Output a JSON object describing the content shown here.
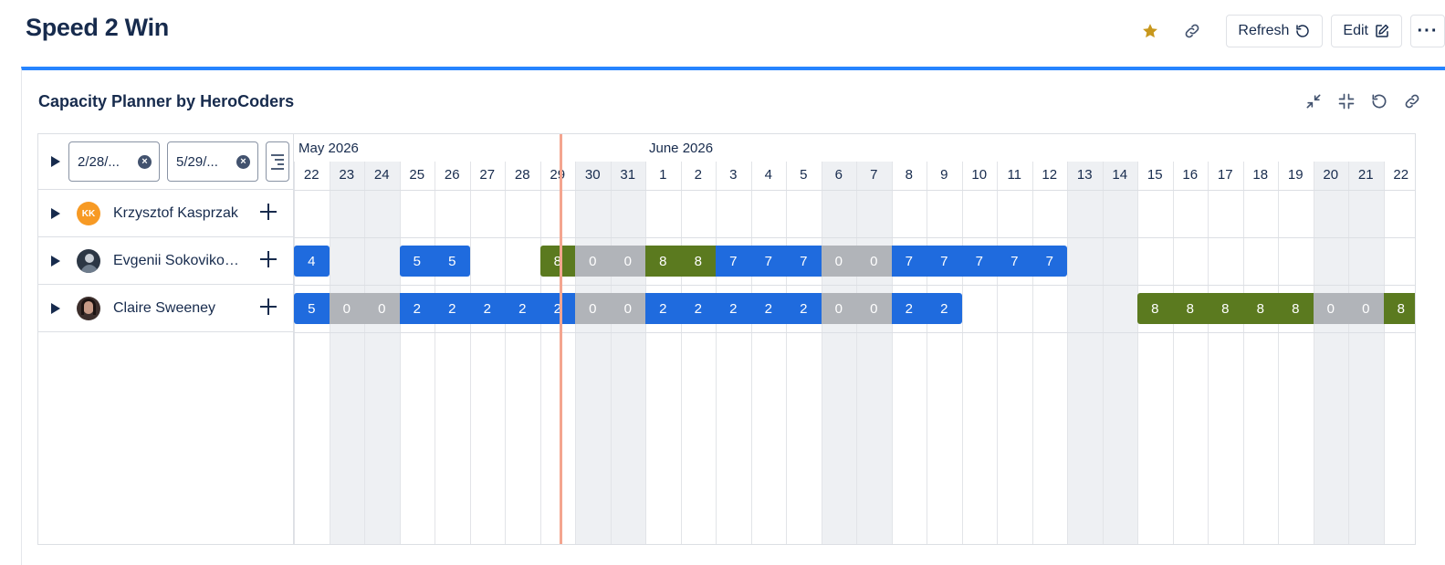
{
  "page": {
    "title": "Speed 2 Win",
    "actions": {
      "refresh_label": "Refresh",
      "edit_label": "Edit",
      "more_label": "···"
    },
    "colors": {
      "star": "#c8981d",
      "accent": "#2684ff"
    }
  },
  "panel": {
    "title": "Capacity Planner by HeroCoders",
    "tools": [
      "collapse-icon",
      "shrink-icon",
      "reset-icon",
      "link-icon"
    ]
  },
  "filters": {
    "start_date": "2/28/...",
    "end_date": "5/29/..."
  },
  "timeline": {
    "months": [
      {
        "label": "May 2026"
      },
      {
        "label": "June 2026"
      }
    ],
    "days": [
      {
        "d": "22",
        "w": false
      },
      {
        "d": "23",
        "w": true
      },
      {
        "d": "24",
        "w": true
      },
      {
        "d": "25",
        "w": false
      },
      {
        "d": "26",
        "w": false
      },
      {
        "d": "27",
        "w": false
      },
      {
        "d": "28",
        "w": false
      },
      {
        "d": "29",
        "w": false
      },
      {
        "d": "30",
        "w": true
      },
      {
        "d": "31",
        "w": true
      },
      {
        "d": "1",
        "w": false
      },
      {
        "d": "2",
        "w": false
      },
      {
        "d": "3",
        "w": false
      },
      {
        "d": "4",
        "w": false
      },
      {
        "d": "5",
        "w": false
      },
      {
        "d": "6",
        "w": true
      },
      {
        "d": "7",
        "w": true
      },
      {
        "d": "8",
        "w": false
      },
      {
        "d": "9",
        "w": false
      },
      {
        "d": "10",
        "w": false
      },
      {
        "d": "11",
        "w": false
      },
      {
        "d": "12",
        "w": false
      },
      {
        "d": "13",
        "w": true
      },
      {
        "d": "14",
        "w": true
      },
      {
        "d": "15",
        "w": false
      },
      {
        "d": "16",
        "w": false
      },
      {
        "d": "17",
        "w": false
      },
      {
        "d": "18",
        "w": false
      },
      {
        "d": "19",
        "w": false
      },
      {
        "d": "20",
        "w": true
      },
      {
        "d": "21",
        "w": true
      },
      {
        "d": "22",
        "w": false
      }
    ],
    "today": "29",
    "colors": {
      "blue": "#1f6bde",
      "green": "#5b7a1f",
      "grey": "#b1b4b9"
    }
  },
  "people": [
    {
      "name": "Krzysztof Kasprzak",
      "initials": "KK",
      "avatar_color": "#f79a24",
      "cells": []
    },
    {
      "name": "Evgenii Sokovikov ...",
      "initials": "",
      "avatar_color": "#3b4a5c",
      "cells": [
        {
          "i": 0,
          "v": "4",
          "c": "blue",
          "first": true,
          "last": true
        },
        {
          "i": 3,
          "v": "5",
          "c": "blue",
          "first": true
        },
        {
          "i": 4,
          "v": "5",
          "c": "blue",
          "last": true
        },
        {
          "i": 7,
          "v": "8",
          "c": "green",
          "first": true
        },
        {
          "i": 8,
          "v": "0",
          "c": "grey"
        },
        {
          "i": 9,
          "v": "0",
          "c": "grey"
        },
        {
          "i": 10,
          "v": "8",
          "c": "green"
        },
        {
          "i": 11,
          "v": "8",
          "c": "green"
        },
        {
          "i": 12,
          "v": "7",
          "c": "blue"
        },
        {
          "i": 13,
          "v": "7",
          "c": "blue"
        },
        {
          "i": 14,
          "v": "7",
          "c": "blue"
        },
        {
          "i": 15,
          "v": "0",
          "c": "grey"
        },
        {
          "i": 16,
          "v": "0",
          "c": "grey"
        },
        {
          "i": 17,
          "v": "7",
          "c": "blue"
        },
        {
          "i": 18,
          "v": "7",
          "c": "blue"
        },
        {
          "i": 19,
          "v": "7",
          "c": "blue"
        },
        {
          "i": 20,
          "v": "7",
          "c": "blue"
        },
        {
          "i": 21,
          "v": "7",
          "c": "blue",
          "last": true
        }
      ]
    },
    {
      "name": "Claire Sweeney",
      "initials": "",
      "avatar_color": "#4a3a3a",
      "cells": [
        {
          "i": 0,
          "v": "5",
          "c": "blue",
          "first": true
        },
        {
          "i": 1,
          "v": "0",
          "c": "grey"
        },
        {
          "i": 2,
          "v": "0",
          "c": "grey"
        },
        {
          "i": 3,
          "v": "2",
          "c": "blue"
        },
        {
          "i": 4,
          "v": "2",
          "c": "blue"
        },
        {
          "i": 5,
          "v": "2",
          "c": "blue"
        },
        {
          "i": 6,
          "v": "2",
          "c": "blue"
        },
        {
          "i": 7,
          "v": "2",
          "c": "blue"
        },
        {
          "i": 8,
          "v": "0",
          "c": "grey"
        },
        {
          "i": 9,
          "v": "0",
          "c": "grey"
        },
        {
          "i": 10,
          "v": "2",
          "c": "blue"
        },
        {
          "i": 11,
          "v": "2",
          "c": "blue"
        },
        {
          "i": 12,
          "v": "2",
          "c": "blue"
        },
        {
          "i": 13,
          "v": "2",
          "c": "blue"
        },
        {
          "i": 14,
          "v": "2",
          "c": "blue"
        },
        {
          "i": 15,
          "v": "0",
          "c": "grey"
        },
        {
          "i": 16,
          "v": "0",
          "c": "grey"
        },
        {
          "i": 17,
          "v": "2",
          "c": "blue"
        },
        {
          "i": 18,
          "v": "2",
          "c": "blue",
          "last": true
        },
        {
          "i": 24,
          "v": "8",
          "c": "green",
          "first": true
        },
        {
          "i": 25,
          "v": "8",
          "c": "green"
        },
        {
          "i": 26,
          "v": "8",
          "c": "green"
        },
        {
          "i": 27,
          "v": "8",
          "c": "green"
        },
        {
          "i": 28,
          "v": "8",
          "c": "green"
        },
        {
          "i": 29,
          "v": "0",
          "c": "grey"
        },
        {
          "i": 30,
          "v": "0",
          "c": "grey"
        },
        {
          "i": 31,
          "v": "8",
          "c": "green"
        }
      ]
    }
  ]
}
